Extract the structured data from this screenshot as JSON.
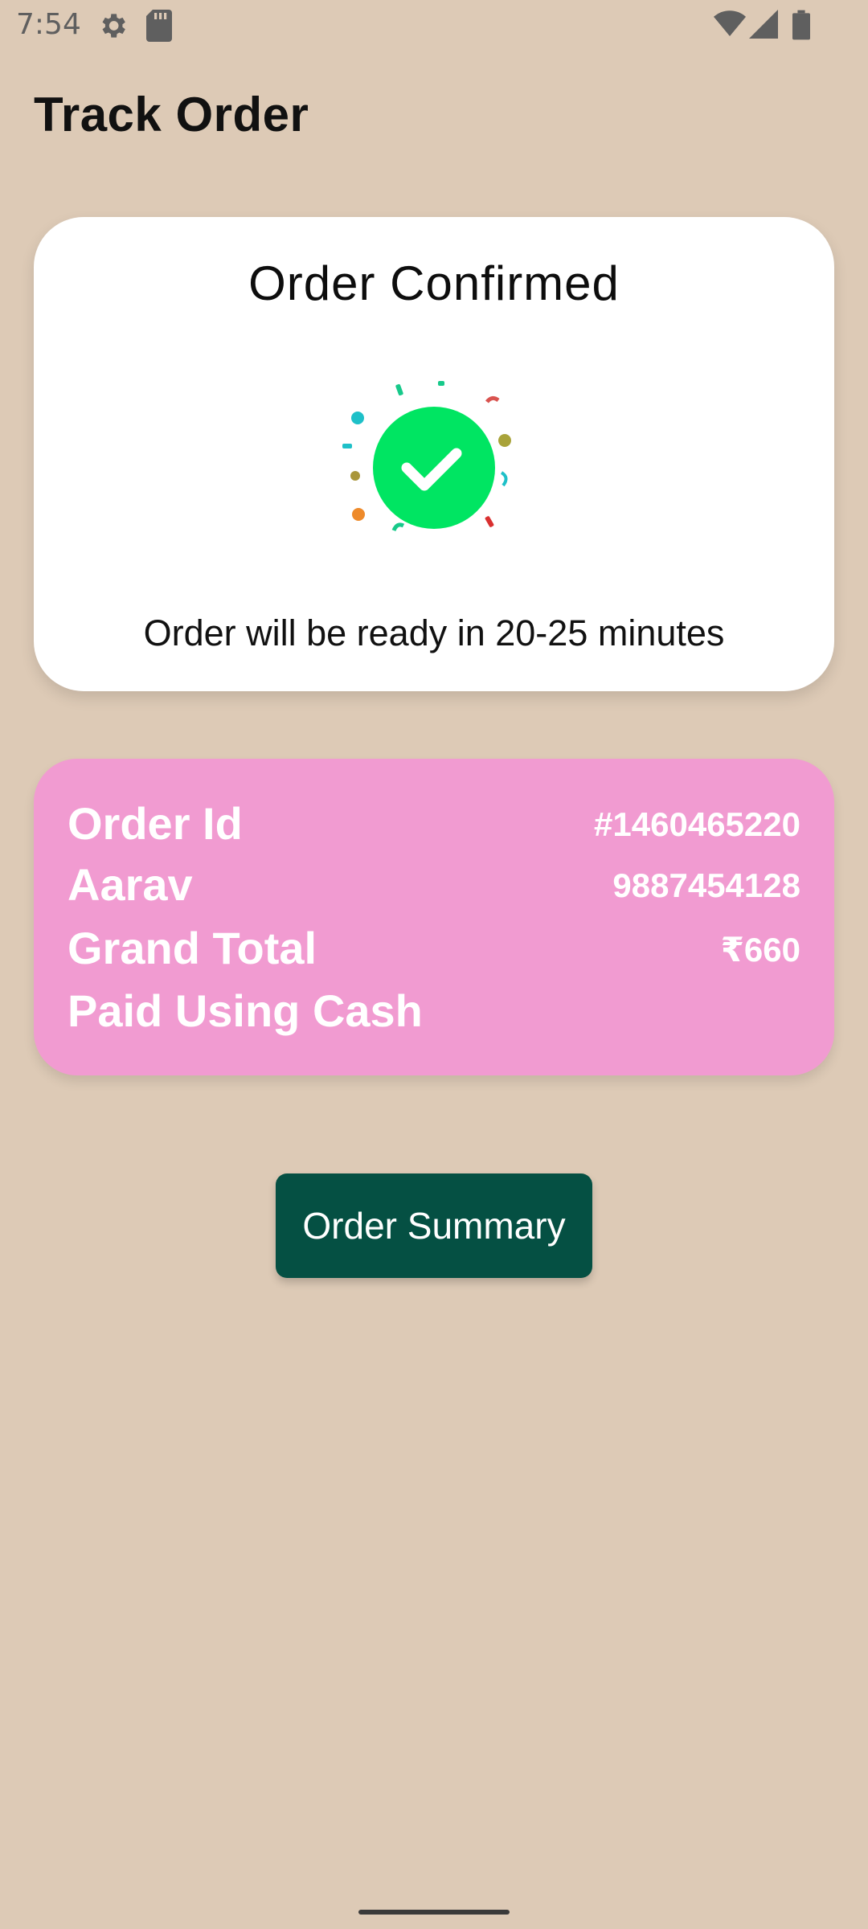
{
  "status_bar": {
    "time": "7:54",
    "icons": [
      "settings-icon",
      "sd-card-icon",
      "wifi-icon",
      "signal-icon",
      "battery-icon"
    ]
  },
  "header": {
    "title": "Track Order"
  },
  "confirmation": {
    "title": "Order Confirmed",
    "icon": "check-circle-icon",
    "message": "Order will be ready in 20-25 minutes",
    "accent_color": "#00E562"
  },
  "order_details": {
    "background_color": "#F19BD1",
    "rows": [
      {
        "label": "Order Id",
        "value": "#1460465220"
      },
      {
        "label": "Aarav",
        "value": "9887454128"
      },
      {
        "label": "Grand Total",
        "value": "₹660"
      },
      {
        "label": "Paid Using Cash",
        "value": ""
      }
    ]
  },
  "actions": {
    "summary_label": "Order Summary",
    "summary_color": "#055043"
  }
}
